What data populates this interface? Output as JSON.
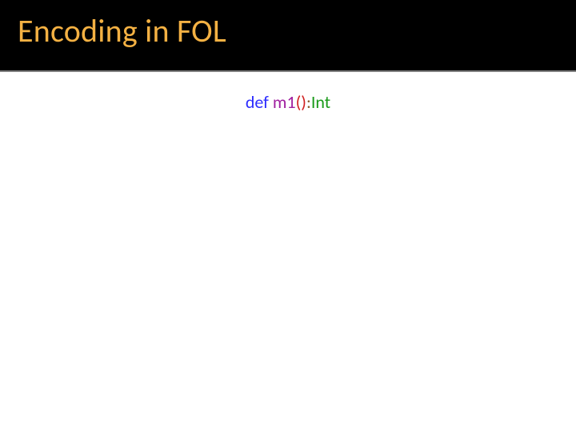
{
  "slide": {
    "title": "Encoding in FOL"
  },
  "code": {
    "def": "def ",
    "name": "m1",
    "paren": "()",
    "colon": ":",
    "type": "Int"
  }
}
